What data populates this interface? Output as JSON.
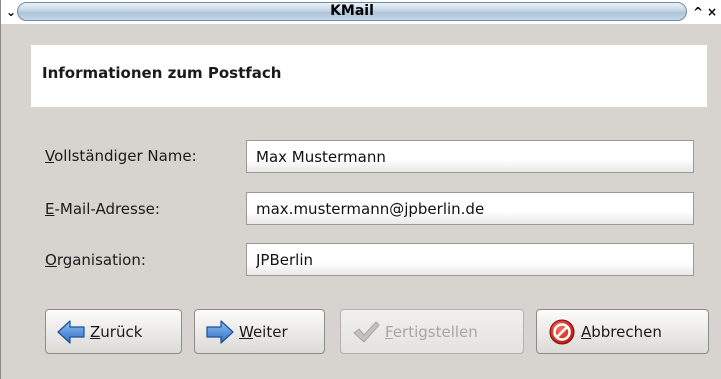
{
  "window": {
    "title": "KMail",
    "menu_glyph": "⌄",
    "maximize_glyph": "^",
    "close_glyph": "×"
  },
  "header": {
    "title": "Informationen zum Postfach"
  },
  "form": {
    "name": {
      "label_accel": "V",
      "label_rest": "ollständiger Name:",
      "value": "Max Mustermann"
    },
    "email": {
      "label_accel": "E",
      "label_rest": "-Mail-Adresse:",
      "value": "max.mustermann@jpberlin.de"
    },
    "organisation": {
      "label_accel": "O",
      "label_rest": "rganisation:",
      "value": "JPBerlin"
    }
  },
  "buttons": {
    "back": {
      "accel": "Z",
      "rest": "urück",
      "icon": "arrow-left-icon",
      "enabled": true
    },
    "next": {
      "accel": "W",
      "rest": "eiter",
      "icon": "arrow-right-icon",
      "enabled": true
    },
    "finish": {
      "accel": "F",
      "rest": "ertigstellen",
      "icon": "checkmark-icon",
      "enabled": false
    },
    "cancel": {
      "accel": "A",
      "rest": "bbrechen",
      "icon": "stop-icon",
      "enabled": true
    }
  },
  "colors": {
    "arrow_blue": "#3f7fd0",
    "cancel_red": "#d8201a",
    "disabled_check": "#b8b6b2"
  }
}
